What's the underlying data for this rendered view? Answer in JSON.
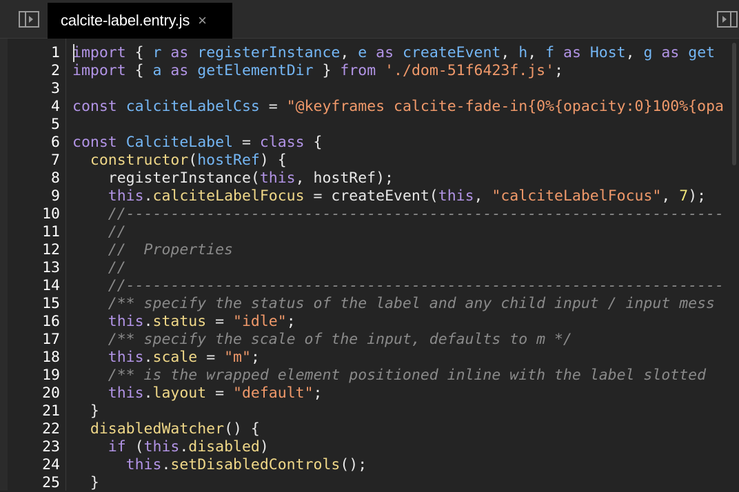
{
  "tab": {
    "title": "calcite-label.entry.js",
    "close": "×"
  },
  "icons": {
    "left": "sidebar-toggle-icon",
    "right": "sidebar-toggle-right-icon"
  },
  "lines": [
    {
      "n": "1",
      "t": [
        [
          "kw",
          "import"
        ],
        [
          "pl",
          " { "
        ],
        [
          "id",
          "r"
        ],
        [
          "kw",
          " as "
        ],
        [
          "id",
          "registerInstance"
        ],
        [
          "pl",
          ", "
        ],
        [
          "id",
          "e"
        ],
        [
          "kw",
          " as "
        ],
        [
          "id",
          "createEvent"
        ],
        [
          "pl",
          ", "
        ],
        [
          "id",
          "h"
        ],
        [
          "pl",
          ", "
        ],
        [
          "id",
          "f"
        ],
        [
          "kw",
          " as "
        ],
        [
          "id",
          "Host"
        ],
        [
          "pl",
          ", "
        ],
        [
          "id",
          "g"
        ],
        [
          "kw",
          " as "
        ],
        [
          "id",
          "get"
        ]
      ]
    },
    {
      "n": "2",
      "t": [
        [
          "kw",
          "import"
        ],
        [
          "pl",
          " { "
        ],
        [
          "id",
          "a"
        ],
        [
          "kw",
          " as "
        ],
        [
          "id",
          "getElementDir"
        ],
        [
          "pl",
          " } "
        ],
        [
          "kw",
          "from"
        ],
        [
          "pl",
          " "
        ],
        [
          "str",
          "'./dom-51f6423f.js'"
        ],
        [
          "pl",
          ";"
        ]
      ]
    },
    {
      "n": "3",
      "t": []
    },
    {
      "n": "4",
      "t": [
        [
          "kw",
          "const"
        ],
        [
          "pl",
          " "
        ],
        [
          "id",
          "calciteLabelCss"
        ],
        [
          "pl",
          " = "
        ],
        [
          "str",
          "\"@keyframes calcite-fade-in{0%{opacity:0}100%{opa"
        ]
      ]
    },
    {
      "n": "5",
      "t": []
    },
    {
      "n": "6",
      "t": [
        [
          "kw",
          "const"
        ],
        [
          "pl",
          " "
        ],
        [
          "id",
          "CalciteLabel"
        ],
        [
          "pl",
          " = "
        ],
        [
          "kw",
          "class"
        ],
        [
          "pl",
          " {"
        ]
      ]
    },
    {
      "n": "7",
      "t": [
        [
          "pl",
          "  "
        ],
        [
          "fn",
          "constructor"
        ],
        [
          "pl",
          "("
        ],
        [
          "id",
          "hostRef"
        ],
        [
          "pl",
          ") {"
        ]
      ]
    },
    {
      "n": "8",
      "t": [
        [
          "pl",
          "    registerInstance("
        ],
        [
          "kw",
          "this"
        ],
        [
          "pl",
          ", hostRef);"
        ]
      ]
    },
    {
      "n": "9",
      "t": [
        [
          "pl",
          "    "
        ],
        [
          "kw",
          "this"
        ],
        [
          "pl",
          "."
        ],
        [
          "fn",
          "calciteLabelFocus"
        ],
        [
          "pl",
          " = createEvent("
        ],
        [
          "kw",
          "this"
        ],
        [
          "pl",
          ", "
        ],
        [
          "str",
          "\"calciteLabelFocus\""
        ],
        [
          "pl",
          ", "
        ],
        [
          "num",
          "7"
        ],
        [
          "pl",
          ");"
        ]
      ]
    },
    {
      "n": "10",
      "t": [
        [
          "pl",
          "    "
        ],
        [
          "cm",
          "//-------------------------------------------------------------------"
        ]
      ]
    },
    {
      "n": "11",
      "t": [
        [
          "pl",
          "    "
        ],
        [
          "cm",
          "//"
        ]
      ]
    },
    {
      "n": "12",
      "t": [
        [
          "pl",
          "    "
        ],
        [
          "cm",
          "//  Properties"
        ]
      ]
    },
    {
      "n": "13",
      "t": [
        [
          "pl",
          "    "
        ],
        [
          "cm",
          "//"
        ]
      ]
    },
    {
      "n": "14",
      "t": [
        [
          "pl",
          "    "
        ],
        [
          "cm",
          "//-------------------------------------------------------------------"
        ]
      ]
    },
    {
      "n": "15",
      "t": [
        [
          "pl",
          "    "
        ],
        [
          "cm",
          "/** specify the status of the label and any child input / input mess"
        ]
      ]
    },
    {
      "n": "16",
      "t": [
        [
          "pl",
          "    "
        ],
        [
          "kw",
          "this"
        ],
        [
          "pl",
          "."
        ],
        [
          "fn",
          "status"
        ],
        [
          "pl",
          " = "
        ],
        [
          "str",
          "\"idle\""
        ],
        [
          "pl",
          ";"
        ]
      ]
    },
    {
      "n": "17",
      "t": [
        [
          "pl",
          "    "
        ],
        [
          "cm",
          "/** specify the scale of the input, defaults to m */"
        ]
      ]
    },
    {
      "n": "18",
      "t": [
        [
          "pl",
          "    "
        ],
        [
          "kw",
          "this"
        ],
        [
          "pl",
          "."
        ],
        [
          "fn",
          "scale"
        ],
        [
          "pl",
          " = "
        ],
        [
          "str",
          "\"m\""
        ],
        [
          "pl",
          ";"
        ]
      ]
    },
    {
      "n": "19",
      "t": [
        [
          "pl",
          "    "
        ],
        [
          "cm",
          "/** is the wrapped element positioned inline with the label slotted"
        ]
      ]
    },
    {
      "n": "20",
      "t": [
        [
          "pl",
          "    "
        ],
        [
          "kw",
          "this"
        ],
        [
          "pl",
          "."
        ],
        [
          "fn",
          "layout"
        ],
        [
          "pl",
          " = "
        ],
        [
          "str",
          "\"default\""
        ],
        [
          "pl",
          ";"
        ]
      ]
    },
    {
      "n": "21",
      "t": [
        [
          "pl",
          "  }"
        ]
      ]
    },
    {
      "n": "22",
      "t": [
        [
          "pl",
          "  "
        ],
        [
          "fn",
          "disabledWatcher"
        ],
        [
          "pl",
          "() {"
        ]
      ]
    },
    {
      "n": "23",
      "t": [
        [
          "pl",
          "    "
        ],
        [
          "kw",
          "if"
        ],
        [
          "pl",
          " ("
        ],
        [
          "kw",
          "this"
        ],
        [
          "pl",
          "."
        ],
        [
          "fn",
          "disabled"
        ],
        [
          "pl",
          ")"
        ]
      ]
    },
    {
      "n": "24",
      "t": [
        [
          "pl",
          "      "
        ],
        [
          "kw",
          "this"
        ],
        [
          "pl",
          "."
        ],
        [
          "fn",
          "setDisabledControls"
        ],
        [
          "pl",
          "();"
        ]
      ]
    },
    {
      "n": "25",
      "t": [
        [
          "pl",
          "  }"
        ]
      ]
    }
  ]
}
